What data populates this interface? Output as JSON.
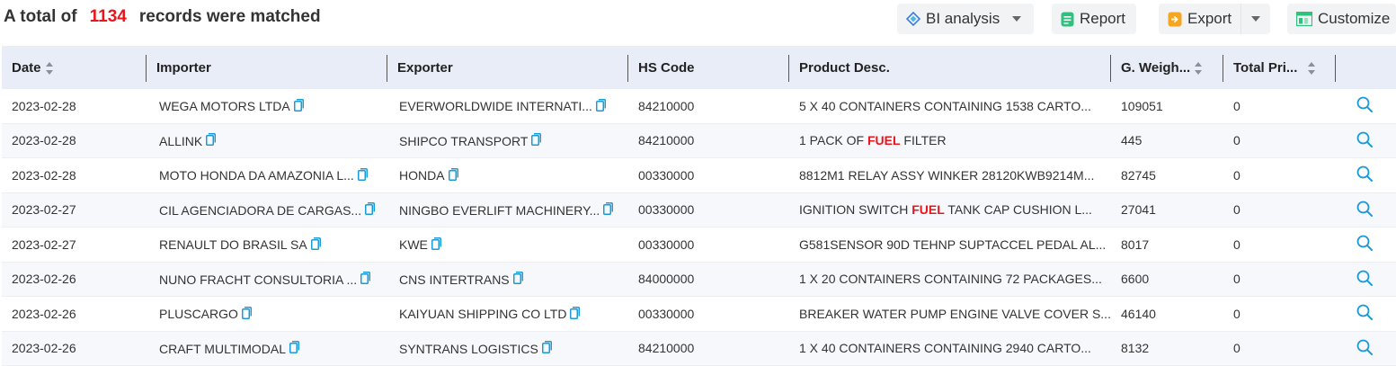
{
  "summary": {
    "prefix": "A total of",
    "count": "1134",
    "suffix": "records were matched"
  },
  "toolbar": {
    "bi_label": "BI analysis",
    "report_label": "Report",
    "export_label": "Export",
    "customize_label": "Customize"
  },
  "columns": {
    "date": "Date",
    "importer": "Importer",
    "exporter": "Exporter",
    "hs": "HS Code",
    "desc": "Product Desc.",
    "weight": "G. Weigh...",
    "price": "Total Pri..."
  },
  "rows": [
    {
      "date": "2023-02-28",
      "importer": "WEGA MOTORS LTDA",
      "exporter": "EVERWORLDWIDE INTERNATI...",
      "hs": "84210000",
      "desc": [
        {
          "t": "5 X 40 CONTAINERS CONTAINING 1538 CARTO...",
          "hl": false
        }
      ],
      "weight": "109051",
      "price": "0"
    },
    {
      "date": "2023-02-28",
      "importer": "ALLINK",
      "exporter": "SHIPCO TRANSPORT",
      "hs": "84210000",
      "desc": [
        {
          "t": "1 PACK OF ",
          "hl": false
        },
        {
          "t": "FUEL",
          "hl": true
        },
        {
          "t": " FILTER",
          "hl": false
        }
      ],
      "weight": "445",
      "price": "0"
    },
    {
      "date": "2023-02-28",
      "importer": "MOTO HONDA DA AMAZONIA L...",
      "exporter": "HONDA",
      "hs": "00330000",
      "desc": [
        {
          "t": "8812M1 RELAY ASSY WINKER 28120KWB9214M...",
          "hl": false
        }
      ],
      "weight": "82745",
      "price": "0"
    },
    {
      "date": "2023-02-27",
      "importer": "CIL AGENCIADORA DE CARGAS...",
      "exporter": "NINGBO EVERLIFT MACHINERY...",
      "hs": "00330000",
      "desc": [
        {
          "t": "IGNITION SWITCH ",
          "hl": false
        },
        {
          "t": "FUEL",
          "hl": true
        },
        {
          "t": " TANK CAP CUSHION L...",
          "hl": false
        }
      ],
      "weight": "27041",
      "price": "0"
    },
    {
      "date": "2023-02-27",
      "importer": "RENAULT DO BRASIL SA",
      "exporter": "KWE",
      "hs": "00330000",
      "desc": [
        {
          "t": "G581SENSOR 90D TEHNP SUPTACCEL PEDAL AL...",
          "hl": false
        }
      ],
      "weight": "8017",
      "price": "0"
    },
    {
      "date": "2023-02-26",
      "importer": "NUNO FRACHT CONSULTORIA ...",
      "exporter": "CNS INTERTRANS",
      "hs": "84000000",
      "desc": [
        {
          "t": "1 X 20 CONTAINERS CONTAINING 72 PACKAGES...",
          "hl": false
        }
      ],
      "weight": "6600",
      "price": "0"
    },
    {
      "date": "2023-02-26",
      "importer": "PLUSCARGO",
      "exporter": "KAIYUAN SHIPPING CO LTD",
      "hs": "00330000",
      "desc": [
        {
          "t": "BREAKER WATER PUMP ENGINE VALVE COVER S...",
          "hl": false
        }
      ],
      "weight": "46140",
      "price": "0"
    },
    {
      "date": "2023-02-26",
      "importer": "CRAFT MULTIMODAL",
      "exporter": "SYNTRANS LOGISTICS",
      "hs": "84210000",
      "desc": [
        {
          "t": "1 X 40 CONTAINERS CONTAINING 2940 CARTO...",
          "hl": false
        }
      ],
      "weight": "8132",
      "price": "0"
    }
  ],
  "icons": {
    "copy": "copy-icon",
    "search": "search-icon",
    "sort": "sort-icon"
  },
  "colors": {
    "accent": "#1a9bd7",
    "count": "#e8161c",
    "header_bg": "#e8edf7"
  }
}
